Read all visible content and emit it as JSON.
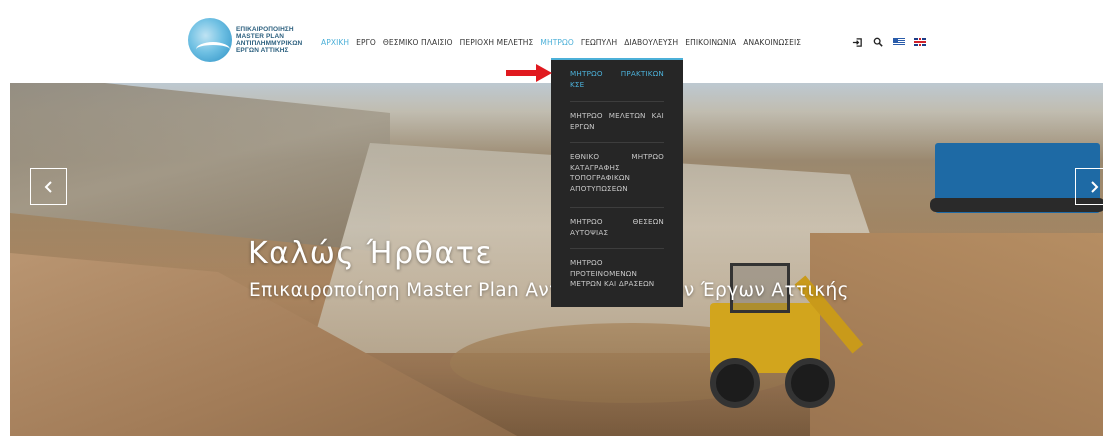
{
  "logo": {
    "lines": [
      "ΕΠΙΚΑΙΡΟΠΟΙΗΣΗ",
      "MASTER PLAN",
      "ΑΝΤΙΠΛΗΜΜΥΡΙΚΩΝ",
      "ΕΡΓΩΝ ΑΤΤΙΚΗΣ"
    ]
  },
  "nav": {
    "items": [
      {
        "label": "ΑΡΧΙΚΗ"
      },
      {
        "label": "ΕΡΓΟ"
      },
      {
        "label": "ΘΕΣΜΙΚΟ ΠΛΑΙΣΙΟ"
      },
      {
        "label": "ΠΕΡΙΟΧΗ ΜΕΛΕΤΗΣ"
      },
      {
        "label": "ΜΗΤΡΩΟ"
      },
      {
        "label": "ΓΕΩΠΥΛΗ"
      },
      {
        "label": "ΔΙΑΒΟΥΛΕΥΣΗ"
      },
      {
        "label": "ΕΠΙΚΟΙΝΩΝΙΑ"
      },
      {
        "label": "ΑΝΑΚΟΙΝΩΣΕΙΣ"
      }
    ],
    "icons": [
      "login-icon",
      "search-icon",
      "greek-flag-icon",
      "uk-flag-icon"
    ]
  },
  "dropdown": {
    "items": [
      {
        "label": "ΜΗΤΡΩΟ ΠΡΑΚΤΙΚΩΝ ΚΣΕ"
      },
      {
        "label": "ΜΗΤΡΩΟ ΜΕΛΕΤΩΝ ΚΑΙ ΕΡΓΩΝ"
      },
      {
        "label": "ΕΘΝΙΚΟ ΜΗΤΡΩΟ ΚΑΤΑΓΡΑΦΗΣ ΤΟΠΟΓΡΑΦΙΚΩΝ ΑΠΟΤΥΠΩΣΕΩΝ"
      },
      {
        "label": "ΜΗΤΡΩΟ ΘΕΣΕΩΝ ΑΥΤΟΨΙΑΣ"
      },
      {
        "label": "ΜΗΤΡΩΟ ΠΡΟΤΕΙΝΟΜΕΝΩΝ ΜΕΤΡΩΝ ΚΑΙ ΔΡΑΣΕΩΝ"
      }
    ]
  },
  "hero": {
    "title": "Καλώς Ήρθατε",
    "subtitle": "Επικαιροποίηση Master Plan Αντιπλημμυρικών Έργων Αττικής"
  },
  "colors": {
    "accent": "#4cb0d8",
    "dropdown_bg": "#262626",
    "arrow": "#e0191f"
  }
}
